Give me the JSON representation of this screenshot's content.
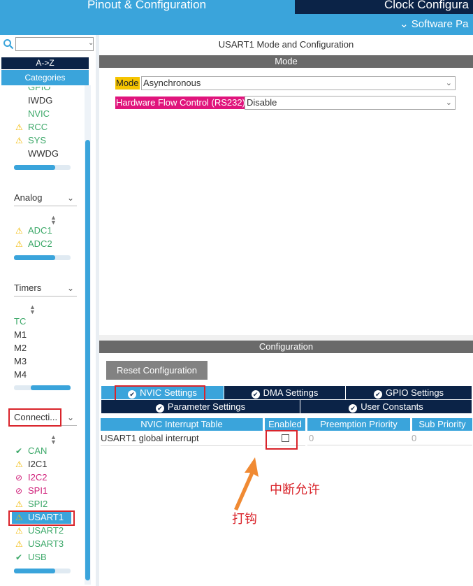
{
  "header": {
    "tab_pinout": "Pinout & Configuration",
    "tab_clock": "Clock Configura",
    "software_packs": "Software Pa",
    "software_packs_icon": "chevron-down-icon"
  },
  "sidebar": {
    "search_value": "",
    "sort_az": "A->Z",
    "categories": "Categories",
    "system_items": [
      {
        "label": "GPIO",
        "status": "none",
        "color": "#3ea96a"
      },
      {
        "label": "IWDG",
        "status": "none",
        "color": "#333333"
      },
      {
        "label": "NVIC",
        "status": "none",
        "color": "#3ea96a"
      },
      {
        "label": "RCC",
        "status": "warning",
        "color": "#3ea96a"
      },
      {
        "label": "SYS",
        "status": "warning",
        "color": "#3ea96a"
      },
      {
        "label": "WWDG",
        "status": "none",
        "color": "#333333"
      }
    ],
    "analog_header": "Analog",
    "analog_items": [
      {
        "label": "ADC1",
        "status": "warning",
        "color": "#3ea96a"
      },
      {
        "label": "ADC2",
        "status": "warning",
        "color": "#3ea96a"
      }
    ],
    "timers_header": "Timers",
    "timers_items": [
      {
        "label": "TC",
        "color": "#3ea96a"
      },
      {
        "label": "M1",
        "color": "#333333"
      },
      {
        "label": "M2",
        "color": "#333333"
      },
      {
        "label": "M3",
        "color": "#333333"
      },
      {
        "label": "M4",
        "color": "#333333"
      }
    ],
    "connectivity_header": "Connecti...",
    "connectivity_items": [
      {
        "label": "CAN",
        "status": "ok",
        "color": "#3ea96a"
      },
      {
        "label": "I2C1",
        "status": "warning",
        "color": "#333333"
      },
      {
        "label": "I2C2",
        "status": "disabled",
        "color": "#d0207a"
      },
      {
        "label": "SPI1",
        "status": "disabled",
        "color": "#d0207a"
      },
      {
        "label": "SPI2",
        "status": "warning",
        "color": "#3ea96a"
      },
      {
        "label": "USART1",
        "status": "warning",
        "color": "#ffffff",
        "selected": true
      },
      {
        "label": "USART2",
        "status": "warning",
        "color": "#3ea96a"
      },
      {
        "label": "USART3",
        "status": "warning",
        "color": "#3ea96a"
      },
      {
        "label": "USB",
        "status": "ok",
        "color": "#3ea96a"
      }
    ]
  },
  "mode_panel": {
    "title": "USART1 Mode and Configuration",
    "section": "Mode",
    "mode_label": "Mode",
    "mode_value": "Asynchronous",
    "flow_label": "Hardware Flow Control (RS232)",
    "flow_value": "Disable"
  },
  "config_panel": {
    "section": "Configuration",
    "reset_button": "Reset Configuration",
    "tabs": {
      "nvic": "NVIC Settings",
      "dma": "DMA Settings",
      "gpio": "GPIO Settings",
      "parameter": "Parameter Settings",
      "user_constants": "User Constants"
    },
    "table": {
      "headers": [
        "NVIC Interrupt Table",
        "Enabled",
        "Preemption Priority",
        "Sub Priority"
      ],
      "rows": [
        {
          "name": "USART1 global interrupt",
          "enabled": false,
          "preemption": "0",
          "sub": "0"
        }
      ]
    }
  },
  "annotations": {
    "interrupt_enable": "中断允许",
    "check_it": "打钩"
  },
  "colors": {
    "accent": "#3aa4db",
    "dark_navy": "#0b2347",
    "highlight_red": "#d9242b",
    "mode_label_bg": "#f6c400",
    "flow_label_bg": "#e0147c"
  }
}
